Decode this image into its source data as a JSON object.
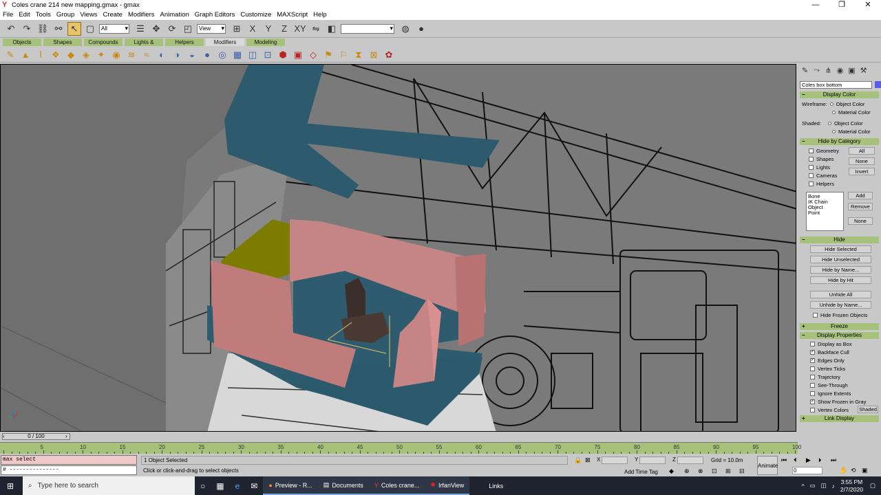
{
  "window": {
    "title": "Coles crane 214 new mapping.gmax - gmax",
    "app_icon": "gmax-icon",
    "controls": [
      "—",
      "❐",
      "✕"
    ]
  },
  "menu": [
    "File",
    "Edit",
    "Tools",
    "Group",
    "Views",
    "Create",
    "Modifiers",
    "Animation",
    "Graph Editors",
    "Customize",
    "MAXScript",
    "Help"
  ],
  "toolbar": {
    "selection_filter": "All",
    "reference_coord": "View",
    "named_selection": ""
  },
  "tabs": [
    "Objects",
    "Shapes",
    "Compounds",
    "Lights & Cameras",
    "Helpers",
    "Modifiers",
    "Modeling"
  ],
  "active_tab": "Modifiers",
  "command_panel": {
    "object_name": "Coles box bottom",
    "object_color": "#5a5af0",
    "display_color": {
      "title": "Display Color",
      "wireframe_label": "Wireframe:",
      "shaded_label": "Shaded:",
      "options": [
        "Object Color",
        "Material Color"
      ]
    },
    "hide_by_category": {
      "title": "Hide by Category",
      "items": [
        "Geometry",
        "Shapes",
        "Lights",
        "Cameras",
        "Helpers"
      ],
      "buttons": [
        "All",
        "None",
        "Invert"
      ],
      "list": [
        "Bone",
        "IK Chain Object",
        "Point"
      ],
      "list_buttons": [
        "Add",
        "Remove",
        "None"
      ]
    },
    "hide": {
      "title": "Hide",
      "buttons": [
        "Hide Selected",
        "Hide Unselected",
        "Hide by Name...",
        "Hide by Hit",
        "Unhide All",
        "Unhide by Name..."
      ],
      "checkbox": "Hide Frozen Objects"
    },
    "freeze": {
      "title": "Freeze"
    },
    "display_properties": {
      "title": "Display Properties",
      "items": [
        {
          "label": "Display as Box",
          "checked": false
        },
        {
          "label": "Backface Cull",
          "checked": true
        },
        {
          "label": "Edges Only",
          "checked": true
        },
        {
          "label": "Vertex Ticks",
          "checked": false
        },
        {
          "label": "Trajectory",
          "checked": false
        },
        {
          "label": "See-Through",
          "checked": false
        },
        {
          "label": "Ignore Extents",
          "checked": false
        },
        {
          "label": "Show Frozen in Gray",
          "checked": true
        },
        {
          "label": "Vertex Colors",
          "checked": false
        }
      ],
      "shaded_button": "Shaded"
    },
    "link_display": {
      "title": "Link Display"
    }
  },
  "timeline": {
    "slider": "0 / 100",
    "ticks": [
      "5",
      "10",
      "15",
      "20",
      "25",
      "30",
      "35",
      "40",
      "45",
      "50",
      "55",
      "60",
      "65",
      "70",
      "75",
      "80",
      "85",
      "90",
      "95",
      "100"
    ]
  },
  "status": {
    "maxscript_line1": "max select",
    "maxscript_line2": "# ---------------",
    "selection": "1 Object Selected",
    "prompt": "Click or click-and-drag to select objects",
    "x_label": "X",
    "y_label": "Y",
    "z_label": "Z",
    "grid": "Grid = 10.0m",
    "add_time_tag": "Add Time Tag",
    "animate": "Animate",
    "frame": "0"
  },
  "taskbar": {
    "search_placeholder": "Type here to search",
    "apps": [
      {
        "name": "Preview - R...",
        "icon": "firefox-icon",
        "open": true
      },
      {
        "name": "Documents",
        "icon": "folder-icon",
        "open": true
      },
      {
        "name": "Coles crane...",
        "icon": "gmax-icon",
        "open": true
      },
      {
        "name": "IrfanView",
        "icon": "irfanview-icon",
        "open": true
      },
      {
        "name": "Links",
        "icon": "",
        "open": false
      }
    ],
    "time": "3:55 PM",
    "date": "2/7/2020"
  }
}
